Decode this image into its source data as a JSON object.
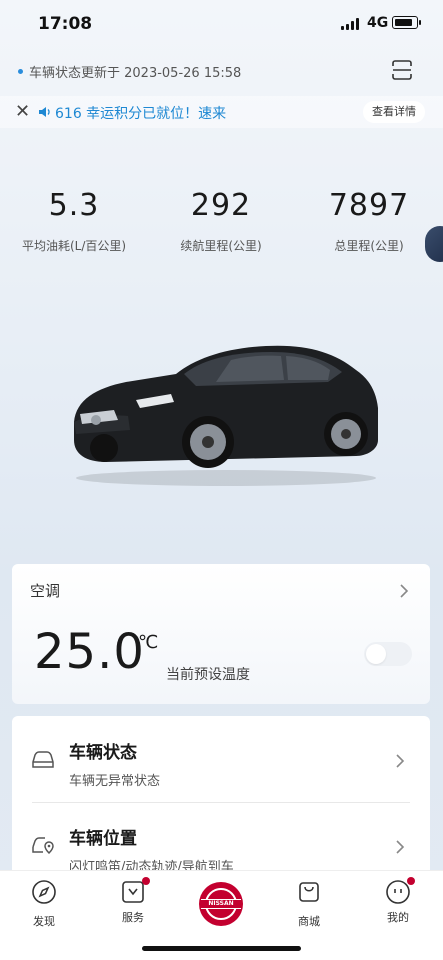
{
  "status_bar": {
    "time": "17:08",
    "network": "4G",
    "battery_level": 0.85
  },
  "header": {
    "update_text": "车辆状态更新于 2023-05-26 15:58",
    "scan_icon": "scan-icon"
  },
  "notice": {
    "text": "616 幸运积分已就位！速来",
    "details_label": "查看详情"
  },
  "stats": [
    {
      "value": "5.3",
      "label": "平均油耗(L/百公里)"
    },
    {
      "value": "292",
      "label": "续航里程(公里)"
    },
    {
      "value": "7897",
      "label": "总里程(公里)"
    }
  ],
  "ac": {
    "title": "空调",
    "temperature": "25.0",
    "unit": "℃",
    "subtitle": "当前预设温度",
    "enabled": false
  },
  "vehicle": {
    "items": [
      {
        "title": "车辆状态",
        "subtitle": "车辆无异常状态",
        "icon": "car-status-icon"
      },
      {
        "title": "车辆位置",
        "subtitle": "闪灯鸣笛/动态轨迹/导航到车",
        "icon": "car-location-icon"
      }
    ]
  },
  "tabbar": {
    "items": [
      {
        "label": "发现",
        "icon": "compass-icon",
        "badge": false
      },
      {
        "label": "服务",
        "icon": "service-icon",
        "badge": true
      },
      {
        "label": "商城",
        "icon": "shopping-bag-icon",
        "badge": false
      },
      {
        "label": "我的",
        "icon": "profile-icon",
        "badge": true
      }
    ],
    "center_logo_text": "NISSAN"
  },
  "colors": {
    "accent_blue": "#1e88d3",
    "brand_red": "#c3002f"
  }
}
